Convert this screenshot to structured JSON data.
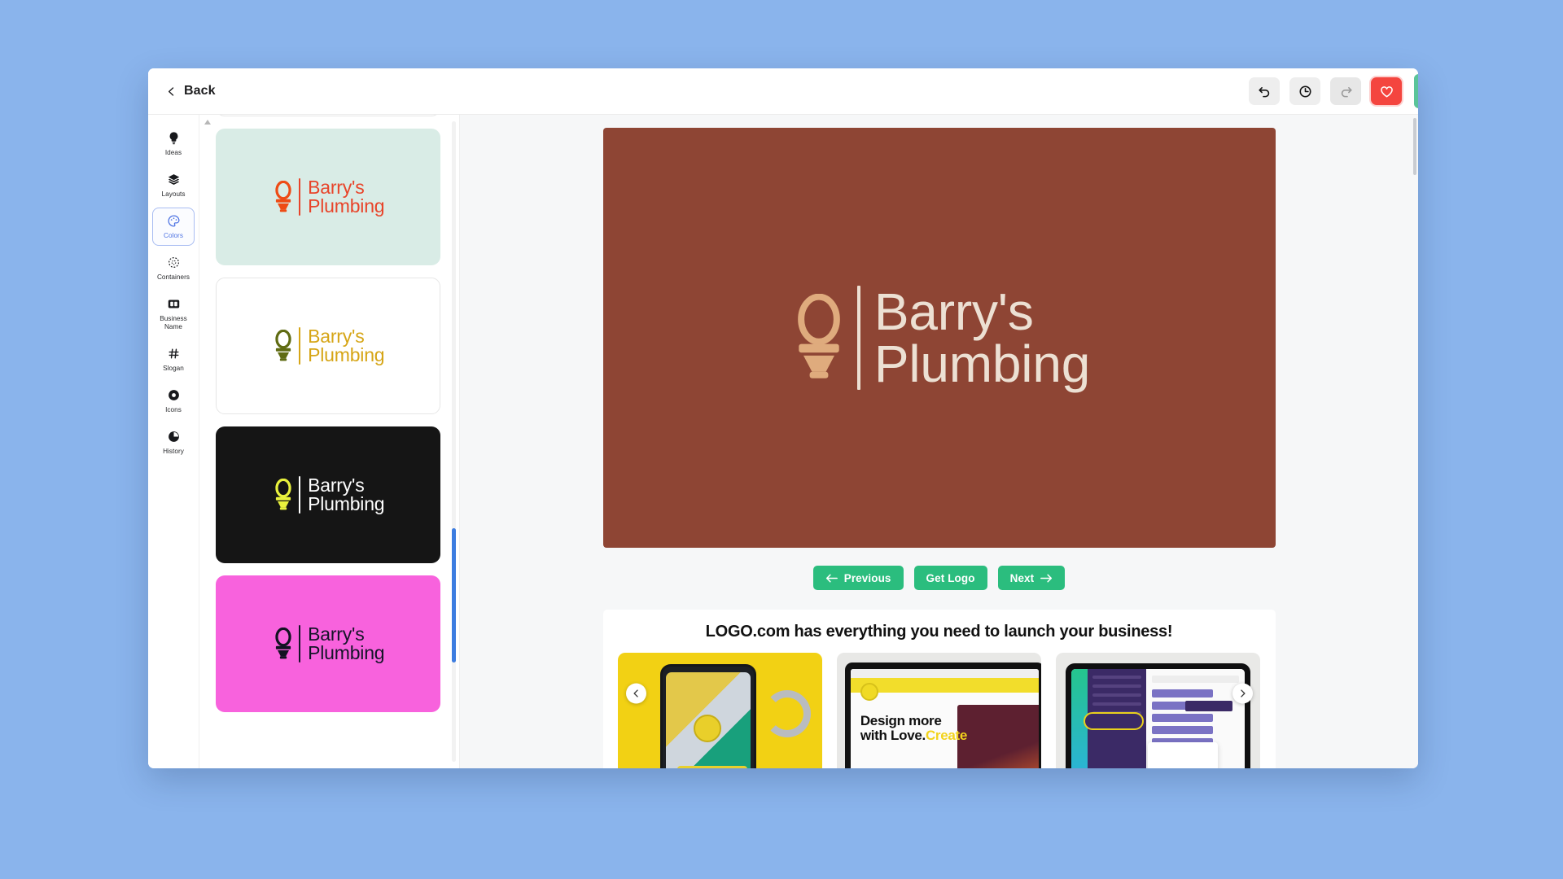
{
  "app": {
    "back_label": "Back"
  },
  "toolbar": {
    "undo": "undo-icon",
    "history": "history-clock-icon",
    "redo": "redo-icon",
    "favorite": "heart-icon"
  },
  "sidebar": {
    "items": [
      {
        "label": "Ideas",
        "icon": "lightbulb-icon",
        "active": false
      },
      {
        "label": "Layouts",
        "icon": "layers-icon",
        "active": false
      },
      {
        "label": "Colors",
        "icon": "color-palette-icon",
        "active": true
      },
      {
        "label": "Containers",
        "icon": "containers-icon",
        "active": false
      },
      {
        "label": "Business Name",
        "icon": "business-name-icon",
        "active": false
      },
      {
        "label": "Slogan",
        "icon": "slogan-hash-icon",
        "active": false
      },
      {
        "label": "Icons",
        "icon": "icons-badge-icon",
        "active": false
      },
      {
        "label": "History",
        "icon": "history-pie-icon",
        "active": false
      }
    ]
  },
  "brand": {
    "line1": "Barry's",
    "line2": "Plumbing",
    "mark": "toilet-icon"
  },
  "variants": [
    {
      "name": "variant-purple-partial",
      "background": "#ffffff",
      "mark_color": "#8a4ad6",
      "text_color": "#8a4ad6",
      "bordered": true,
      "partial": true
    },
    {
      "name": "variant-mint",
      "background": "#d9ece6",
      "mark_color": "#ee4b15",
      "text_color": "#e8442a",
      "bordered": false,
      "partial": false
    },
    {
      "name": "variant-white-olive",
      "background": "#ffffff",
      "mark_color": "#5f6b12",
      "text_color": "#d6a516",
      "bordered": true,
      "partial": false
    },
    {
      "name": "variant-black",
      "background": "#151515",
      "mark_color": "#e9f23d",
      "text_color": "#ffffff",
      "bordered": false,
      "partial": false
    },
    {
      "name": "variant-pink",
      "background": "#f862dd",
      "mark_color": "#121222",
      "text_color": "#141428",
      "bordered": false,
      "partial": false
    }
  ],
  "preview": {
    "background": "#8e4534",
    "mark_color": "#dfab7d",
    "text_color": "#ece0d3"
  },
  "nav": {
    "previous_label": "Previous",
    "get_logo_label": "Get Logo",
    "next_label": "Next",
    "accent": "#2bbd7e"
  },
  "promo": {
    "title": "LOGO.com has everything you need to launch your business!",
    "cards": [
      {
        "name": "promo-card-phone-case",
        "caption": ""
      },
      {
        "name": "promo-card-website",
        "caption_line1": "Design more",
        "caption_line2": "with Love.",
        "caption_hl": "Create"
      },
      {
        "name": "promo-card-dashboard",
        "caption": ""
      }
    ],
    "prev_arrow": "chevron-left-icon",
    "next_arrow": "chevron-right-icon"
  }
}
